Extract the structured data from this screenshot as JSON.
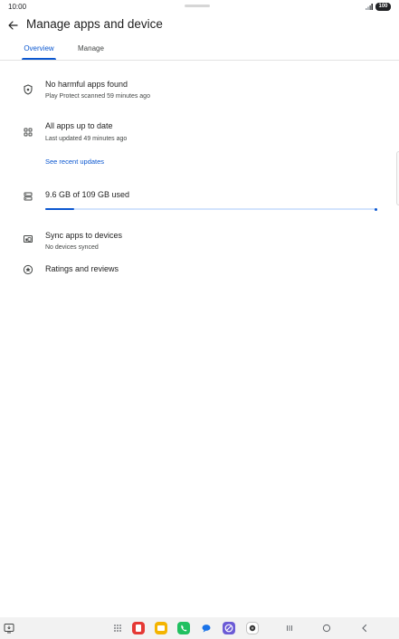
{
  "status_bar": {
    "time": "10:00",
    "battery": "100",
    "icons": [
      "signal-icon",
      "battery-icon"
    ]
  },
  "header": {
    "title": "Manage apps and device",
    "back_icon": "back-arrow-icon"
  },
  "tabs": [
    {
      "label": "Overview",
      "selected": true
    },
    {
      "label": "Manage",
      "selected": false
    }
  ],
  "overview": {
    "protect": {
      "icon": "shield-icon",
      "title": "No harmful apps found",
      "subtitle": "Play Protect scanned 59 minutes ago"
    },
    "updates": {
      "icon": "apps-grid-icon",
      "title": "All apps up to date",
      "subtitle": "Last updated 49 minutes ago",
      "link": "See recent updates"
    },
    "storage": {
      "icon": "storage-icon",
      "title": "9.6 GB of 109 GB used",
      "used_gb": 9.6,
      "total_gb": 109
    },
    "sync": {
      "icon": "sync-devices-icon",
      "title": "Sync apps to devices",
      "subtitle": "No devices synced"
    },
    "ratings": {
      "icon": "star-circle-icon",
      "title": "Ratings and reviews"
    }
  },
  "nav_bar": {
    "left_icon": "screenshot-tray-icon",
    "apps": [
      "app-drawer-icon",
      "red-app-icon",
      "yellow-notes-icon",
      "phone-icon",
      "messages-icon",
      "purple-app-icon",
      "camera-icon"
    ],
    "buttons": [
      "recents-button",
      "home-button",
      "back-button"
    ],
    "colors": {
      "accent": "#0b57d0",
      "red_app": "#e53935",
      "yellow_app": "#f4b400",
      "phone": "#20c060",
      "messages": "#1a73e8",
      "purple_app": "#6b5bd6"
    }
  }
}
